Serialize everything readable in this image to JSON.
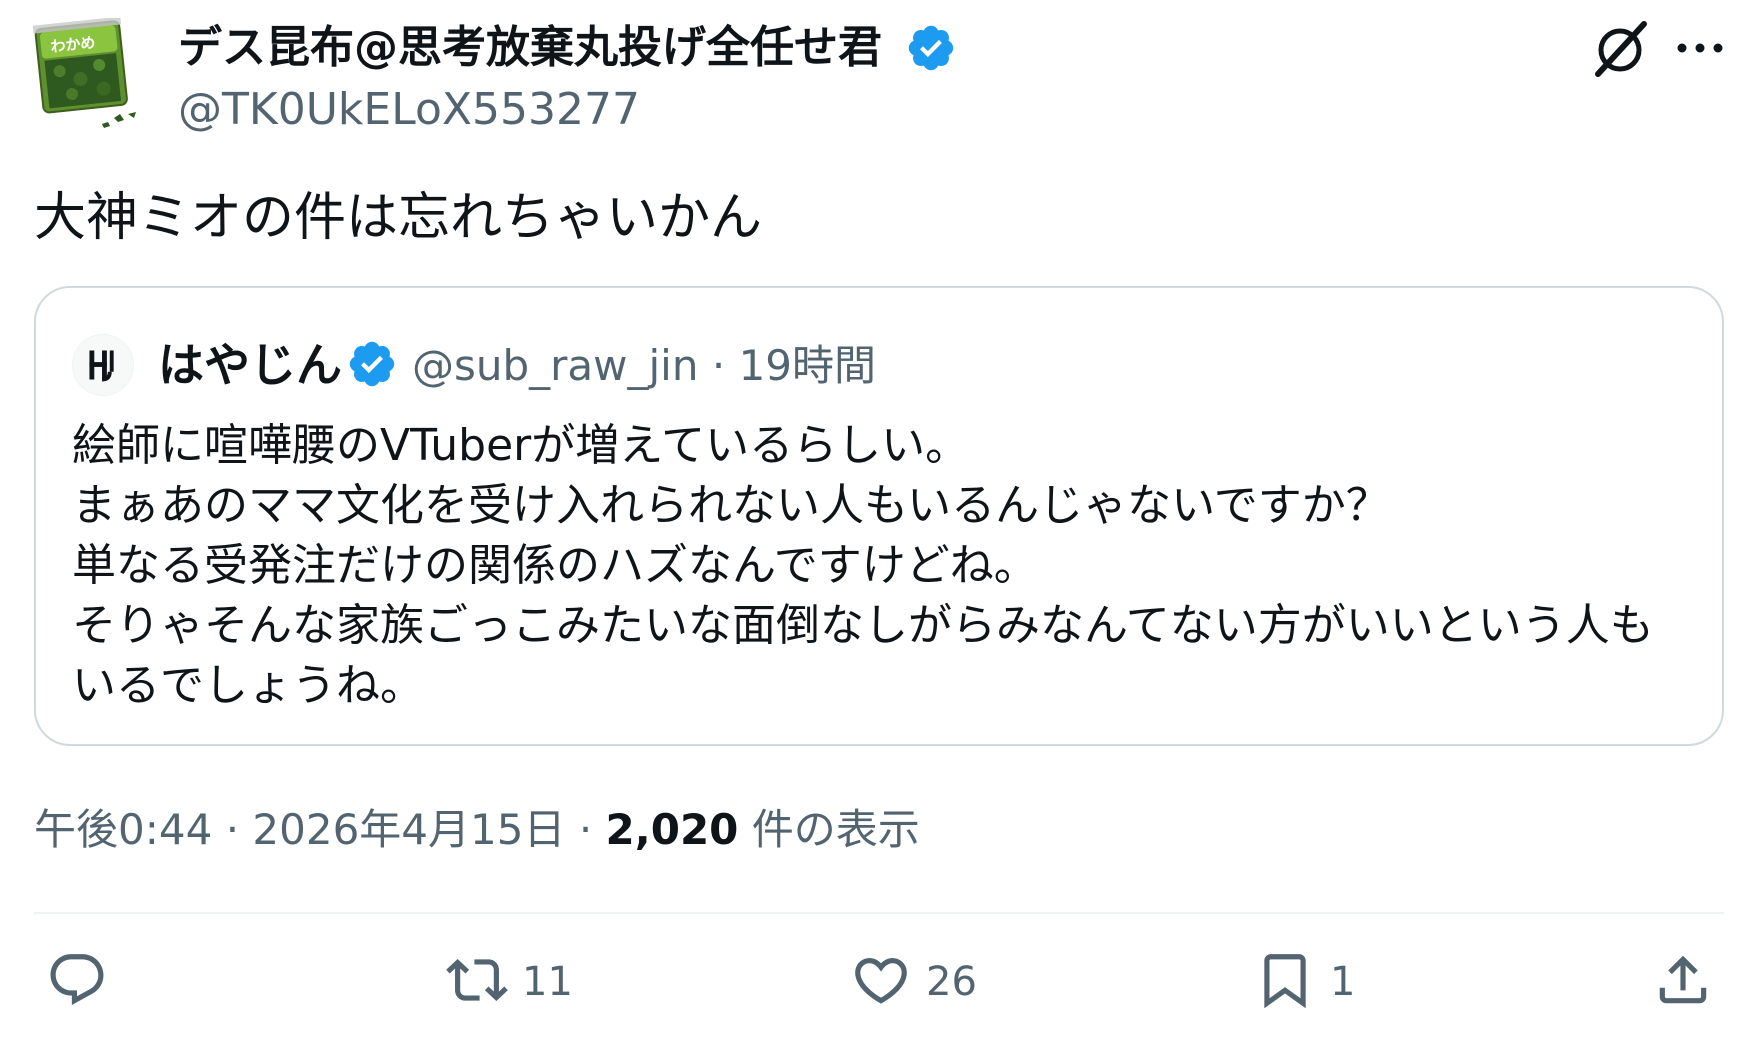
{
  "author": {
    "display_name": "デス昆布@思考放棄丸投げ全任せ君",
    "handle": "@TK0UkELoX553277",
    "avatar_label": "わかめ"
  },
  "tweet": {
    "text": "大神ミオの件は忘れちゃいかん"
  },
  "quote": {
    "display_name": "はやじん",
    "handle": "@sub_raw_jin",
    "separator": "·",
    "time": "19時間",
    "lines": [
      "絵師に喧嘩腰のVTuberが増えているらしい。",
      "まぁあのママ文化を受け入れられない人もいるんじゃないですか？",
      "単なる受発注だけの関係のハズなんですけどね。",
      "そりゃそんな家族ごっこみたいな面倒なしがらみなんてない方がいいという人も",
      "いるでしょうね。"
    ]
  },
  "meta": {
    "time": "午後0:44",
    "separator": "·",
    "date": "2026年4月15日",
    "separator2": "·",
    "views_count": "2,020",
    "views_label": "件の表示"
  },
  "actions": {
    "reply_count": "",
    "retweet_count": "11",
    "like_count": "26",
    "bookmark_count": "1"
  },
  "colors": {
    "verified": "#1d9bf0",
    "text_primary": "#0f1419",
    "text_secondary": "#536471",
    "border": "#cfd9de",
    "seaweed_green": "#3f7f2a",
    "package_green": "#6fb52c"
  },
  "icons": {
    "grok": "grok-icon",
    "more": "more-icon",
    "reply": "reply-icon",
    "retweet": "retweet-icon",
    "like": "heart-icon",
    "bookmark": "bookmark-icon",
    "share": "share-icon",
    "verified": "verified-badge-icon"
  }
}
